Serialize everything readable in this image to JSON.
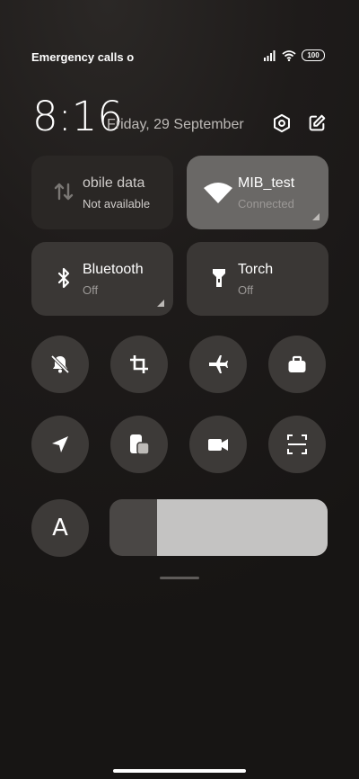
{
  "status_bar": {
    "carrier_text": "Emergency calls o",
    "battery": "100"
  },
  "header": {
    "time": "8:16",
    "date": "Friday, 29 September"
  },
  "tiles": {
    "mobile_data": {
      "label": "obile data",
      "sub": "Not available"
    },
    "wifi": {
      "label": "MIB_test",
      "sub": "Connected"
    },
    "bluetooth": {
      "label": "Bluetooth",
      "sub": "Off"
    },
    "torch": {
      "label": "Torch",
      "sub": "Off"
    }
  },
  "font_button": {
    "label": "A"
  },
  "brightness": {
    "level": 0.78
  },
  "icons": [
    "settings-icon",
    "edit-icon",
    "mobile-data-icon",
    "wifi-icon",
    "bluetooth-icon",
    "torch-icon",
    "mute-icon",
    "screenshot-crop-icon",
    "airplane-icon",
    "work-bag-icon",
    "location-icon",
    "floating-window-icon",
    "video-icon",
    "scanner-icon"
  ]
}
